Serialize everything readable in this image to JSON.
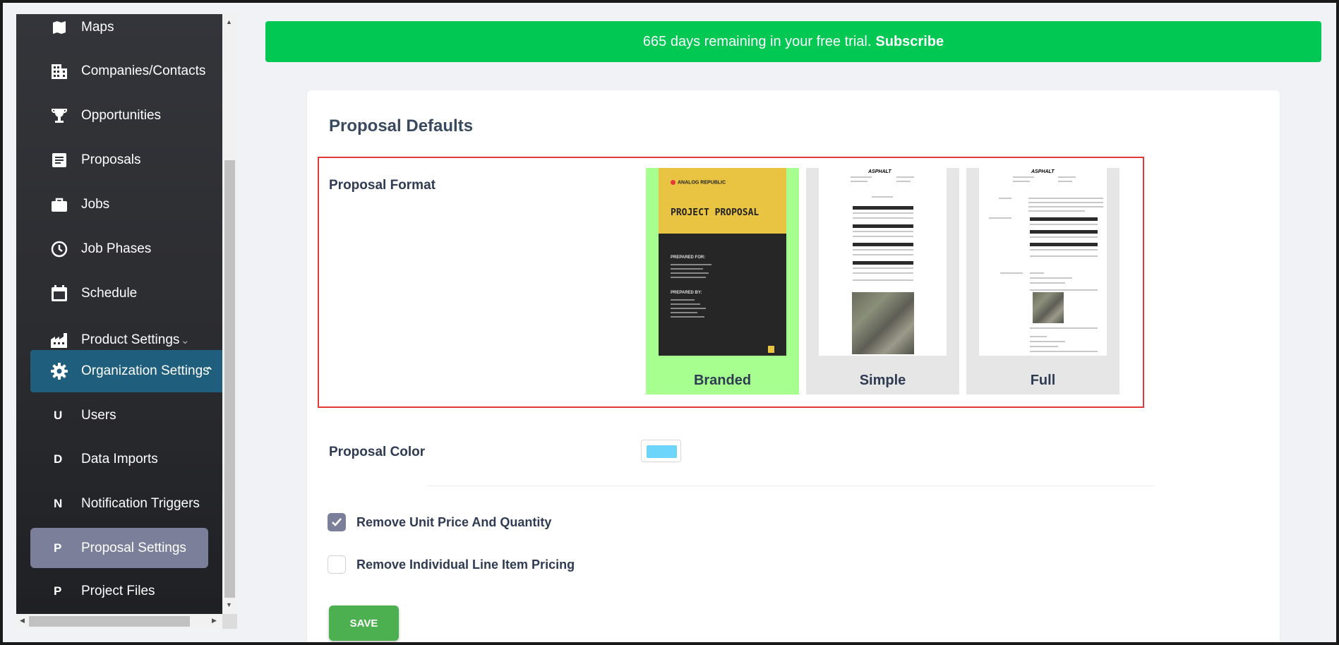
{
  "banner": {
    "text": "665 days remaining in your free trial.",
    "link": "Subscribe"
  },
  "sidebar": {
    "items": [
      {
        "label": "Maps",
        "icon": "map-icon"
      },
      {
        "label": "Companies/Contacts",
        "icon": "building-icon"
      },
      {
        "label": "Opportunities",
        "icon": "trophy-icon"
      },
      {
        "label": "Proposals",
        "icon": "document-icon"
      },
      {
        "label": "Jobs",
        "icon": "briefcase-icon"
      },
      {
        "label": "Job Phases",
        "icon": "clock-icon"
      },
      {
        "label": "Schedule",
        "icon": "calendar-icon"
      },
      {
        "label": "Product Settings",
        "icon": "factory-icon"
      },
      {
        "label": "Organization Settings",
        "icon": "gear-icon"
      }
    ],
    "subitems": [
      {
        "letter": "U",
        "label": "Users"
      },
      {
        "letter": "D",
        "label": "Data Imports"
      },
      {
        "letter": "N",
        "label": "Notification Triggers"
      },
      {
        "letter": "P",
        "label": "Proposal Settings"
      },
      {
        "letter": "P",
        "label": "Project Files"
      }
    ]
  },
  "card": {
    "title": "Proposal Defaults",
    "format_label": "Proposal Format",
    "formats": [
      {
        "label": "Branded",
        "selected": true
      },
      {
        "label": "Simple",
        "selected": false
      },
      {
        "label": "Full",
        "selected": false
      }
    ],
    "branded_preview": {
      "logo": "ANALOG REPUBLIC",
      "heading": "PROJECT PROPOSAL",
      "prepared_for": "PREPARED FOR:",
      "prepared_by": "PREPARED BY:"
    },
    "doc_logo": "ASPHALT",
    "color_label": "Proposal Color",
    "color_value": "#6dd4fa",
    "options": [
      {
        "label": "Remove Unit Price And Quantity",
        "checked": true
      },
      {
        "label": "Remove Individual Line Item Pricing",
        "checked": false
      }
    ],
    "save_label": "SAVE"
  },
  "colors": {
    "banner": "#00c853",
    "active_org": "#1f5f7d",
    "active_sub": "#7b7f9a",
    "selected_format": "#a6ff8f",
    "save": "#4caf50"
  }
}
